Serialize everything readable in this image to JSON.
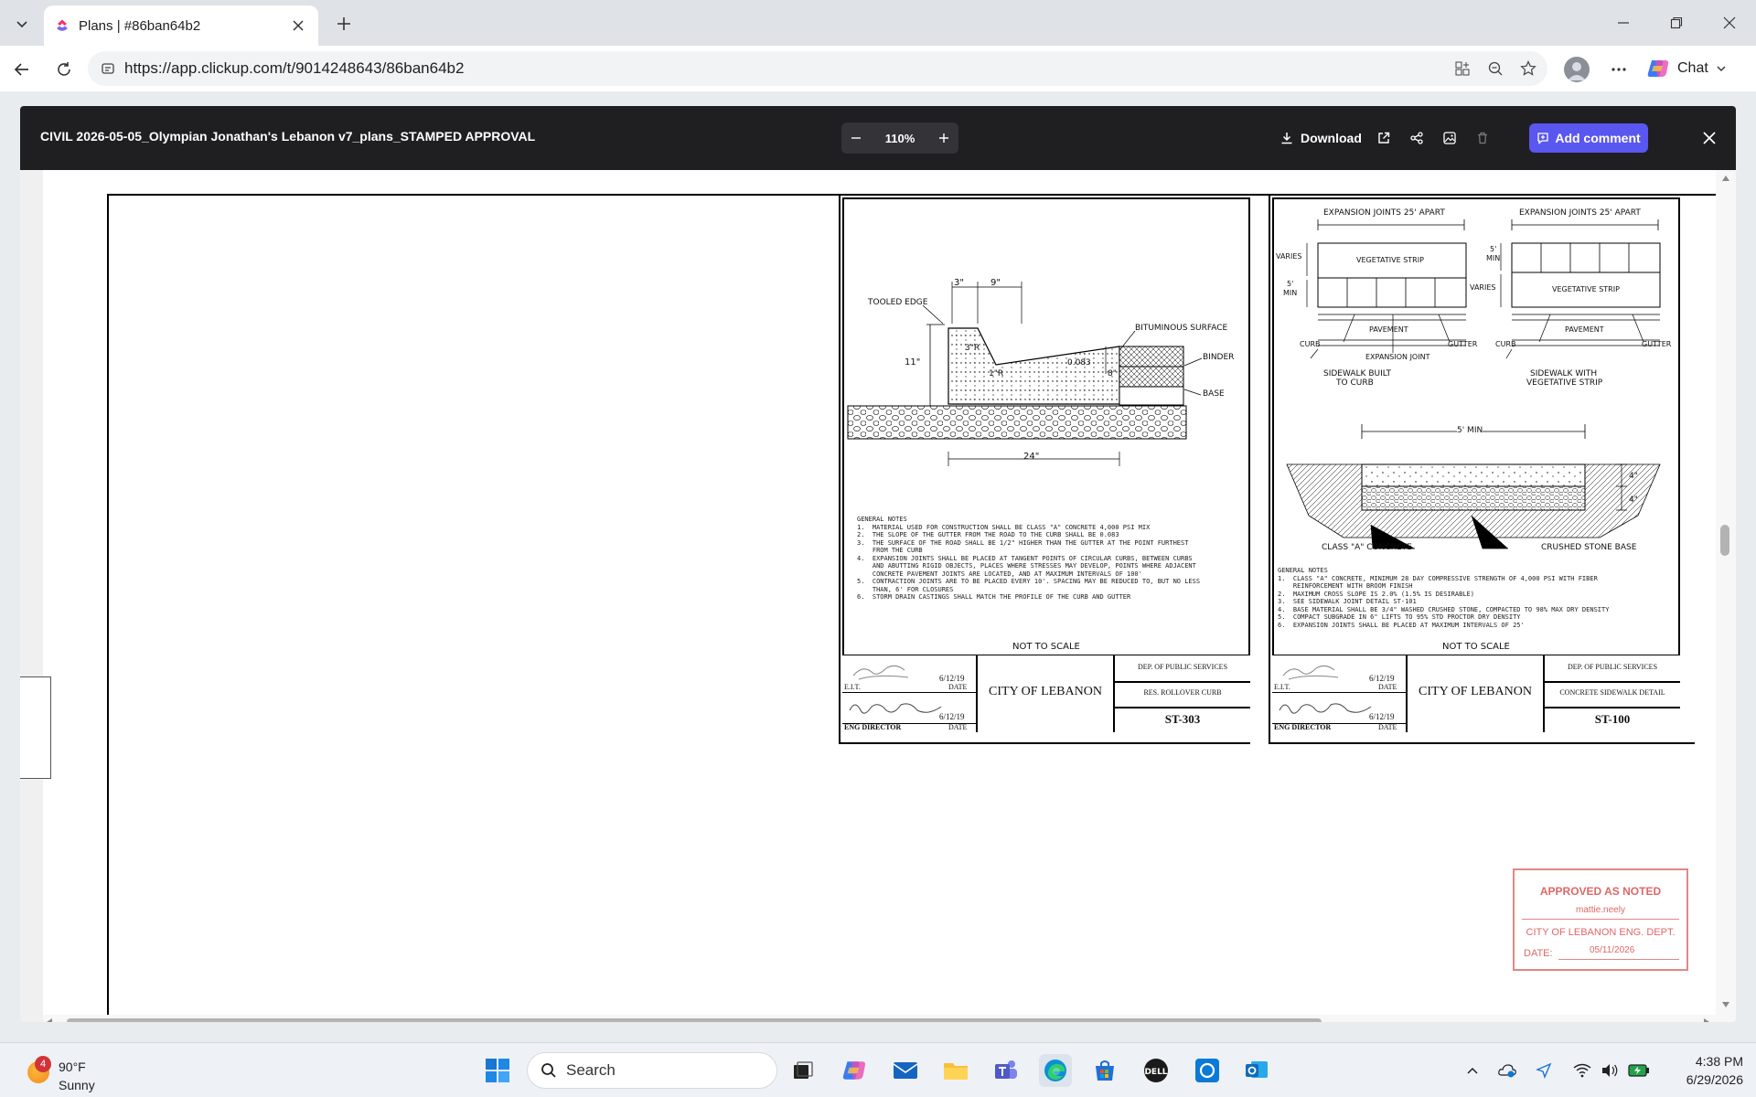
{
  "browser": {
    "tab_title": "Plans | #86ban64b2",
    "url": "https://app.clickup.com/t/9014248643/86ban64b2",
    "chat_label": "Chat"
  },
  "viewer": {
    "title": "CIVIL 2026-05-05_Olympian Jonathan's Lebanon v7_plans_STAMPED APPROVAL",
    "zoom": "110%",
    "download_label": "Download",
    "add_comment_label": "Add comment"
  },
  "drawing_left": {
    "dims": {
      "d3": "3\"",
      "d9": "9\"",
      "d11": "11\"",
      "d24": "24\"",
      "r3": "3\"R",
      "r1": "1\"R",
      "slope": "0.083",
      "d8": "8\""
    },
    "labels": {
      "tooled_edge": "TOOLED EDGE",
      "bituminous": "BITUMINOUS SURFACE",
      "binder": "BINDER",
      "base": "BASE"
    },
    "notes_title": "GENERAL NOTES",
    "notes": [
      "1.  MATERIAL USED FOR CONSTRUCTION SHALL BE CLASS \"A\" CONCRETE 4,000 PSI MIX",
      "2.  THE SLOPE OF THE GUTTER FROM THE ROAD TO THE CURB SHALL BE 0.083",
      "3.  THE SURFACE OF THE ROAD SHALL BE 1/2\" HIGHER THAN THE GUTTER AT THE POINT FURTHEST",
      "    FROM THE CURB",
      "4.  EXPANSION JOINTS SHALL BE PLACED AT TANGENT POINTS OF CIRCULAR CURBS, BETWEEN CURBS",
      "    AND ABUTTING RIGID OBJECTS, PLACES WHERE STRESSES MAY DEVELOP, POINTS WHERE ADJACENT",
      "    CONCRETE PAVEMENT JOINTS ARE LOCATED, AND AT MAXIMUM INTERVALS OF 100'",
      "5.  CONTRACTION JOINTS ARE TO BE PLACED EVERY 10'. SPACING MAY BE REDUCED TO, BUT NO LESS",
      "    THAN, 6' FOR CLOSURES",
      "6.  STORM DRAIN CASTINGS SHALL MATCH THE PROFILE OF THE CURB AND GUTTER"
    ],
    "scale_note": "NOT TO SCALE",
    "title_block": {
      "eit_label": "E.I.T.",
      "date_label": "DATE",
      "date1": "6/12/19",
      "date2": "6/12/19",
      "director_label": "ENG DIRECTOR",
      "city": "CITY OF LEBANON",
      "dept": "DEP. OF PUBLIC SERVICES",
      "sheet_desc": "RES. ROLLOVER CURB",
      "sheet_no": "ST-303"
    }
  },
  "drawing_right": {
    "labels": {
      "exp_joints_a": "EXPANSION JOINTS 25' APART",
      "exp_joints_b": "EXPANSION JOINTS 25' APART",
      "varies_a": "VARIES",
      "min5_a": "5'",
      "min_a": "MIN",
      "veg_strip_a": "VEGETATIVE STRIP",
      "pavement_a": "PAVEMENT",
      "curb_a": "CURB",
      "gutter_a": "GUTTER",
      "exp_joint": "EXPANSION JOINT",
      "sidewalk_curb": "SIDEWALK BUILT",
      "sidewalk_curb2": "TO CURB",
      "min5_b": "5'",
      "min_b": "MIN",
      "varies_b": "VARIES",
      "veg_strip_b": "VEGETATIVE STRIP",
      "pavement_b": "PAVEMENT",
      "curb_b": "CURB",
      "gutter_b": "GUTTER",
      "sidewalk_veg": "SIDEWALK WITH",
      "sidewalk_veg2": "VEGETATIVE STRIP",
      "min_width": "5' MIN",
      "d4a": "4\"",
      "d4b": "4\"",
      "concrete": "CLASS \"A\" CONCRETE",
      "stone": "CRUSHED STONE BASE"
    },
    "notes_title": "GENERAL NOTES",
    "notes": [
      "1.  CLASS \"A\" CONCRETE, MINIMUM 28 DAY COMPRESSIVE STRENGTH OF 4,000 PSI WITH FIBER",
      "    REINFORCEMENT WITH BROOM FINISH",
      "2.  MAXIMUM CROSS SLOPE IS 2.0% (1.5% IS DESIRABLE)",
      "3.  SEE SIDEWALK JOINT DETAIL ST-101",
      "4.  BASE MATERIAL SHALL BE 3/4\" WASHED CRUSHED STONE, COMPACTED TO 98% MAX DRY DENSITY",
      "5.  COMPACT SUBGRADE IN 6\" LIFTS TO 95% STD PROCTOR DRY DENSITY",
      "6.  EXPANSION JOINTS SHALL BE PLACED AT MAXIMUM INTERVALS OF 25'"
    ],
    "scale_note": "NOT TO SCALE",
    "title_block": {
      "eit_label": "E.I.T.",
      "date_label": "DATE",
      "date1": "6/12/19",
      "date2": "6/12/19",
      "director_label": "ENG DIRECTOR",
      "city": "CITY OF LEBANON",
      "dept": "DEP. OF PUBLIC SERVICES",
      "sheet_desc": "CONCRETE SIDEWALK DETAIL",
      "sheet_no": "ST-100"
    }
  },
  "stamp": {
    "line1": "APPROVED AS NOTED",
    "signer": "mattie.neely",
    "line2": "CITY OF LEBANON ENG. DEPT.",
    "date_label": "DATE:",
    "date": "05/11/2026"
  },
  "taskbar": {
    "weather_badge": "4",
    "temp": "90°F",
    "condition": "Sunny",
    "search_label": "Search",
    "time": "4:38 PM",
    "date": "6/29/2026"
  },
  "colors": {
    "accent": "#5a56f0",
    "viewer_header": "#1f1f22",
    "stamp": "#e06767"
  }
}
